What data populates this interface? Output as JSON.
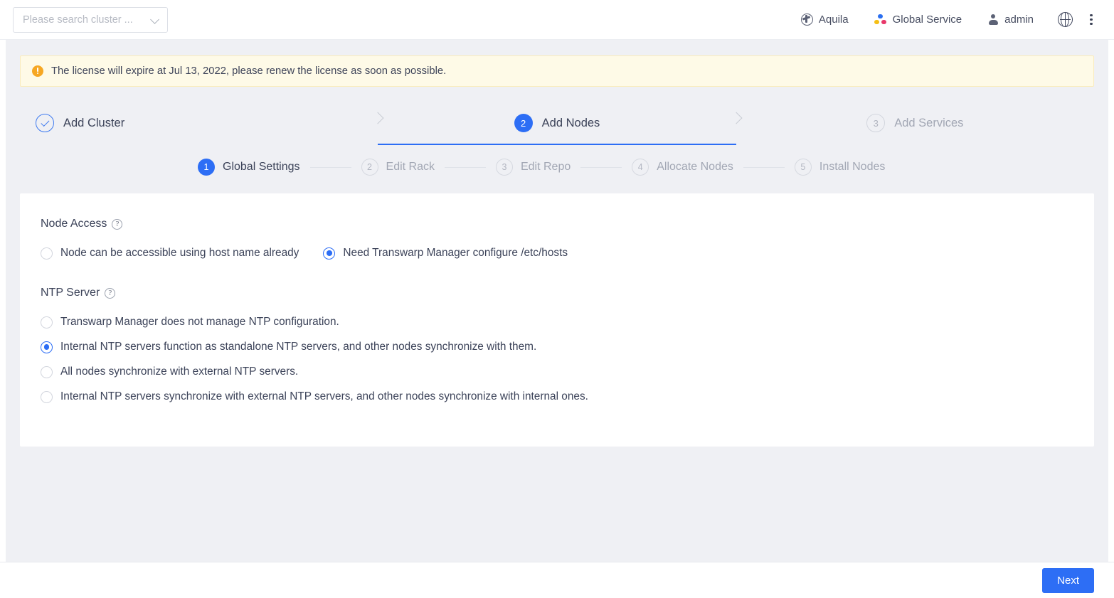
{
  "header": {
    "cluster_search": {
      "placeholder": "Please search cluster ...",
      "value": ""
    },
    "items": [
      {
        "label": "Aquila",
        "icon": "aquila-icon"
      },
      {
        "label": "Global Service",
        "icon": "global-service-icon"
      },
      {
        "label": "admin",
        "icon": "user-icon"
      }
    ],
    "language_icon": "globe-icon",
    "more_icon": "kebab-menu-icon"
  },
  "notice": {
    "icon": "warning-icon",
    "text": "The license will expire at Jul 13, 2022, please renew the license as soon as possible."
  },
  "wizard": {
    "main_steps": [
      {
        "num": "1",
        "label": "Add Cluster",
        "state": "done"
      },
      {
        "num": "2",
        "label": "Add Nodes",
        "state": "active"
      },
      {
        "num": "3",
        "label": "Add Services",
        "state": "idle"
      }
    ],
    "sub_steps": [
      {
        "num": "1",
        "label": "Global Settings",
        "state": "active"
      },
      {
        "num": "2",
        "label": "Edit Rack",
        "state": "idle"
      },
      {
        "num": "3",
        "label": "Edit Repo",
        "state": "idle"
      },
      {
        "num": "4",
        "label": "Allocate Nodes",
        "state": "idle"
      },
      {
        "num": "5",
        "label": "Install Nodes",
        "state": "idle"
      }
    ]
  },
  "form": {
    "node_access": {
      "title": "Node Access",
      "help": "?",
      "options": [
        {
          "label": "Node can be accessible using host name already",
          "selected": false
        },
        {
          "label": "Need Transwarp Manager configure /etc/hosts",
          "selected": true
        }
      ]
    },
    "ntp_server": {
      "title": "NTP Server",
      "help": "?",
      "options": [
        {
          "label": "Transwarp Manager does not manage NTP configuration.",
          "selected": false
        },
        {
          "label": "Internal NTP servers function as standalone NTP servers, and other nodes synchronize with them.",
          "selected": true
        },
        {
          "label": "All nodes synchronize with external NTP servers.",
          "selected": false
        },
        {
          "label": "Internal NTP servers synchronize with external NTP servers, and other nodes synchronize with internal ones.",
          "selected": false
        }
      ]
    }
  },
  "footer": {
    "next_label": "Next"
  },
  "colors": {
    "accent": "#2d6ef5",
    "warning": "#f6a723",
    "notice_bg": "#fefae7",
    "page_bg": "#eff0f4",
    "text": "#3c4359",
    "muted": "#a2a7b4"
  }
}
